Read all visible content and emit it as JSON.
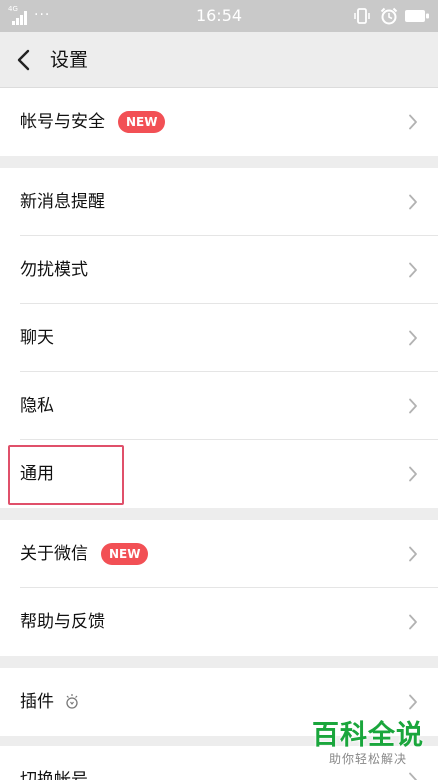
{
  "status_bar": {
    "network": "4G",
    "dots": "···",
    "time": "16:54",
    "icons": [
      "signal-icon",
      "vibrate-icon",
      "alarm-icon",
      "battery-icon"
    ]
  },
  "navbar": {
    "back_icon": "chevron-left-icon",
    "title": "设置"
  },
  "groups": [
    {
      "items": [
        {
          "label": "帐号与安全",
          "badge": "NEW"
        }
      ]
    },
    {
      "items": [
        {
          "label": "新消息提醒"
        },
        {
          "label": "勿扰模式"
        },
        {
          "label": "聊天"
        },
        {
          "label": "隐私"
        },
        {
          "label": "通用"
        }
      ]
    },
    {
      "items": [
        {
          "label": "关于微信",
          "badge": "NEW"
        },
        {
          "label": "帮助与反馈"
        }
      ]
    },
    {
      "items": [
        {
          "label": "插件",
          "icon": "plugin-bulb-icon"
        }
      ]
    },
    {
      "items": [
        {
          "label": "切换帐号"
        }
      ]
    }
  ],
  "watermark": {
    "title": "百科全说",
    "subtitle": "助你轻松解决"
  },
  "colors": {
    "badge": "#f25055",
    "highlight_box": "#e0506a",
    "watermark": "#1aa63c"
  }
}
